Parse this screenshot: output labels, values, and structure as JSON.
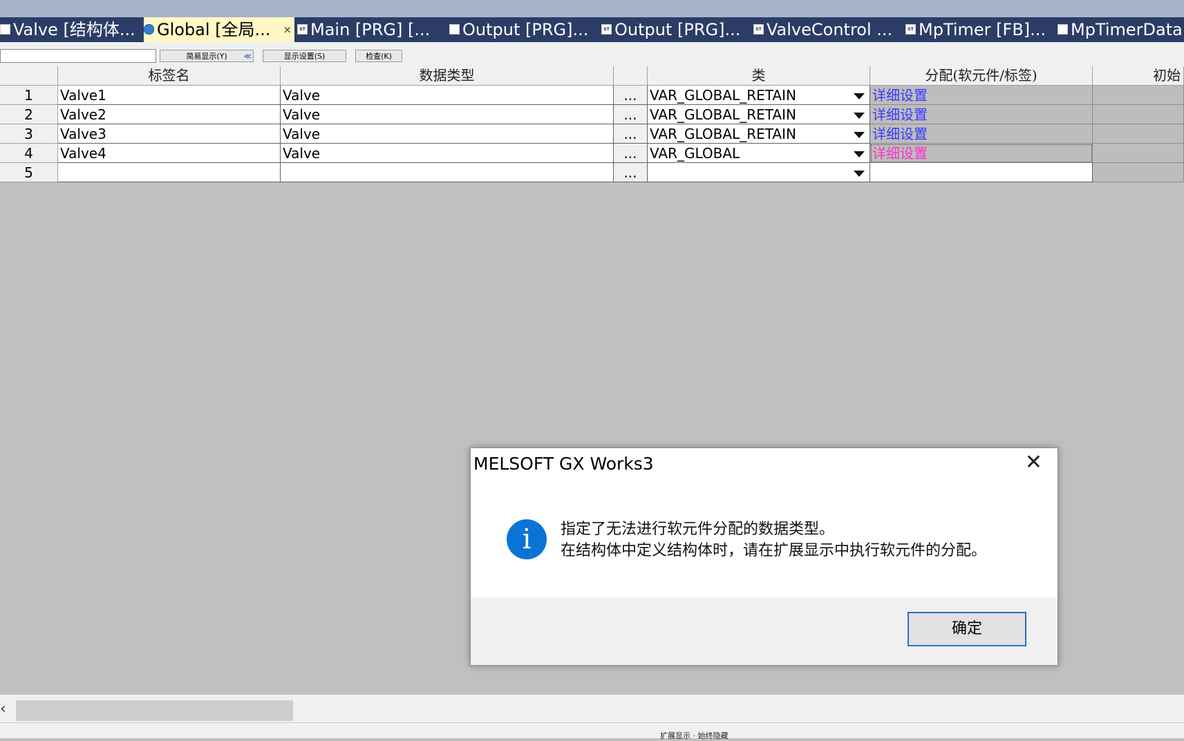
{
  "tabs": [
    {
      "label": "Valve [结构体...",
      "icon": "struct-icon",
      "active": false
    },
    {
      "label": "Global [全局...",
      "icon": "globe-icon",
      "active": true
    },
    {
      "label": "Main [PRG] [...",
      "icon": "st-program-icon",
      "active": false
    },
    {
      "label": "Output [PRG]...",
      "icon": "ladder-program-icon",
      "active": false
    },
    {
      "label": "Output [PRG]...",
      "icon": "st-program-icon",
      "active": false
    },
    {
      "label": "ValveControl ...",
      "icon": "st-program-icon",
      "active": false
    },
    {
      "label": "MpTimer [FB]...",
      "icon": "st-program-icon",
      "active": false
    },
    {
      "label": "MpTimerData...",
      "icon": "struct-icon",
      "active": false
    }
  ],
  "tab_close": "×",
  "toolbar": {
    "simple_display": "简易显示(Y)",
    "collapse_glyph": "≪",
    "display_settings": "显示设置(S)",
    "check": "检查(K)"
  },
  "table": {
    "headers": {
      "name": "标签名",
      "datatype": "数据类型",
      "class": "类",
      "assign": "分配(软元件/标签)",
      "initial": "初始"
    },
    "dots": "...",
    "rows": [
      {
        "no": "1",
        "name": "Valve1",
        "type": "Valve",
        "class": "VAR_GLOBAL_RETAIN",
        "assign": "详细设置"
      },
      {
        "no": "2",
        "name": "Valve2",
        "type": "Valve",
        "class": "VAR_GLOBAL_RETAIN",
        "assign": "详细设置"
      },
      {
        "no": "3",
        "name": "Valve3",
        "type": "Valve",
        "class": "VAR_GLOBAL_RETAIN",
        "assign": "详细设置"
      },
      {
        "no": "4",
        "name": "Valve4",
        "type": "Valve",
        "class": "VAR_GLOBAL",
        "assign": "详细设置"
      },
      {
        "no": "5",
        "name": "",
        "type": "",
        "class": "",
        "assign": ""
      }
    ]
  },
  "dialog": {
    "title": "MELSOFT GX Works3",
    "close": "✕",
    "icon": "info-icon",
    "icon_glyph": "i",
    "message_line1": "指定了无法进行软元件分配的数据类型。",
    "message_line2": "在结构体中定义结构体时，请在扩展显示中执行软元件的分配。",
    "ok": "确定"
  },
  "scroll_left": "‹",
  "status": "扩展显示 · 始终隐藏",
  "colors": {
    "tabbar": "#2b3d66",
    "active_tab": "#fff7c4",
    "assign_link": "#3a3aff",
    "assign_link_selected": "#ff33cc",
    "info_blue": "#0a74d6"
  }
}
